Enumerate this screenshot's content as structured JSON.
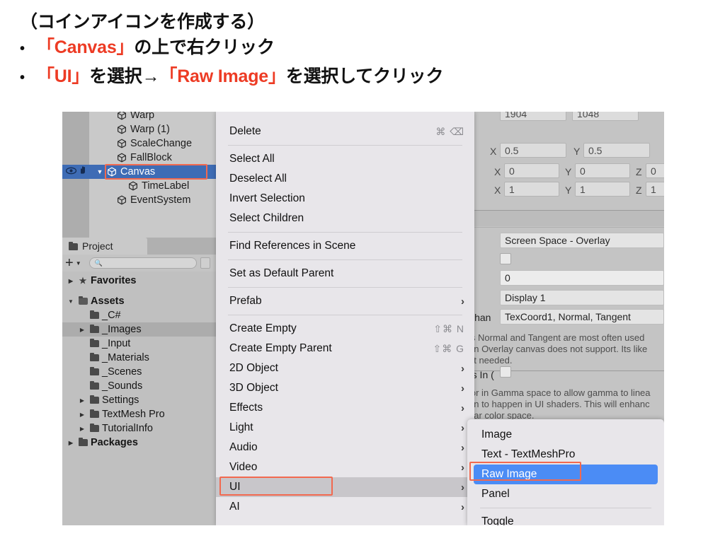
{
  "slide": {
    "title": "（コインアイコンを作成する）",
    "bullets": [
      {
        "marker": "•",
        "parts": [
          {
            "text": "「Canvas」",
            "color": "red"
          },
          {
            "text": "の上で右クリック",
            "color": "black"
          }
        ]
      },
      {
        "marker": "•",
        "parts": [
          {
            "text": "「UI」",
            "color": "red"
          },
          {
            "text": "を選択→",
            "color": "black"
          },
          {
            "text": "「Raw Image」",
            "color": "red"
          },
          {
            "text": "を選択してクリック",
            "color": "black"
          }
        ]
      }
    ],
    "line1_red": "「Canvas」",
    "line1_black": "の上で右クリック",
    "line2_red_a": "「UI」",
    "line2_black_a": "を選択→",
    "line2_red_b": "「Raw Image」",
    "line2_black_b": "を選択してクリック"
  },
  "colors": {
    "accent_red": "#ed3b24",
    "highlight_box": "#f2694f",
    "selection_blue": "#3e6cb5",
    "submenu_blue": "#4b8cf5",
    "panel_gray": "#c9c9c9",
    "menu_bg": "#e8e6ea"
  },
  "hierarchy": {
    "rows": [
      {
        "label": "Warp",
        "indent": 22,
        "triangle": "",
        "selected": false
      },
      {
        "label": "Warp (1)",
        "indent": 22,
        "triangle": "",
        "selected": false
      },
      {
        "label": "ScaleChange",
        "indent": 22,
        "triangle": "",
        "selected": false
      },
      {
        "label": "FallBlock",
        "indent": 22,
        "triangle": "",
        "selected": false
      },
      {
        "label": "Canvas",
        "indent": 8,
        "triangle": "▼",
        "selected": true
      },
      {
        "label": "TimeLabel",
        "indent": 38,
        "triangle": "",
        "selected": false
      },
      {
        "label": "EventSystem",
        "indent": 22,
        "triangle": "",
        "selected": false
      }
    ],
    "gutter_icons": [
      "eye-icon",
      "hand-icon"
    ]
  },
  "project": {
    "tab_label": "Project",
    "add_label": "+",
    "search_value": "",
    "search_placeholder": "",
    "tree": [
      {
        "label": "Favorites",
        "arrow": "▶",
        "icon": "star",
        "indent": 4,
        "bold": true,
        "highlight": false
      },
      {
        "label": "Assets",
        "arrow": "▼",
        "icon": "folder-open",
        "indent": 4,
        "bold": true,
        "highlight": false
      },
      {
        "label": "_C#",
        "arrow": "",
        "icon": "folder",
        "indent": 20,
        "bold": false,
        "highlight": false
      },
      {
        "label": "_Images",
        "arrow": "▶",
        "icon": "folder",
        "indent": 20,
        "bold": false,
        "highlight": true
      },
      {
        "label": "_Input",
        "arrow": "",
        "icon": "folder",
        "indent": 20,
        "bold": false,
        "highlight": false
      },
      {
        "label": "_Materials",
        "arrow": "",
        "icon": "folder",
        "indent": 20,
        "bold": false,
        "highlight": false
      },
      {
        "label": "_Scenes",
        "arrow": "",
        "icon": "folder",
        "indent": 20,
        "bold": false,
        "highlight": false
      },
      {
        "label": "_Sounds",
        "arrow": "",
        "icon": "folder",
        "indent": 20,
        "bold": false,
        "highlight": false
      },
      {
        "label": "Settings",
        "arrow": "▶",
        "icon": "folder",
        "indent": 20,
        "bold": false,
        "highlight": false
      },
      {
        "label": "TextMesh Pro",
        "arrow": "▶",
        "icon": "folder",
        "indent": 20,
        "bold": false,
        "highlight": false
      },
      {
        "label": "TutorialInfo",
        "arrow": "▶",
        "icon": "folder",
        "indent": 20,
        "bold": false,
        "highlight": false
      },
      {
        "label": "Packages",
        "arrow": "▶",
        "icon": "folder",
        "indent": 4,
        "bold": true,
        "highlight": false
      }
    ]
  },
  "context_menu": {
    "items": [
      {
        "label": "Delete",
        "shortcut": "⌘ ⌫",
        "arrow": false,
        "sep_after": true
      },
      {
        "label": "Select All",
        "shortcut": "",
        "arrow": false,
        "sep_after": false
      },
      {
        "label": "Deselect All",
        "shortcut": "",
        "arrow": false,
        "sep_after": false
      },
      {
        "label": "Invert Selection",
        "shortcut": "",
        "arrow": false,
        "sep_after": false
      },
      {
        "label": "Select Children",
        "shortcut": "",
        "arrow": false,
        "sep_after": true
      },
      {
        "label": "Find References in Scene",
        "shortcut": "",
        "arrow": false,
        "sep_after": true
      },
      {
        "label": "Set as Default Parent",
        "shortcut": "",
        "arrow": false,
        "sep_after": true
      },
      {
        "label": "Prefab",
        "shortcut": "",
        "arrow": true,
        "sep_after": true
      },
      {
        "label": "Create Empty",
        "shortcut": "⇧⌘ N",
        "arrow": false,
        "sep_after": false
      },
      {
        "label": "Create Empty Parent",
        "shortcut": "⇧⌘ G",
        "arrow": false,
        "sep_after": false
      },
      {
        "label": "2D Object",
        "shortcut": "",
        "arrow": true,
        "sep_after": false
      },
      {
        "label": "3D Object",
        "shortcut": "",
        "arrow": true,
        "sep_after": false
      },
      {
        "label": "Effects",
        "shortcut": "",
        "arrow": true,
        "sep_after": false
      },
      {
        "label": "Light",
        "shortcut": "",
        "arrow": true,
        "sep_after": false
      },
      {
        "label": "Audio",
        "shortcut": "",
        "arrow": true,
        "sep_after": false
      },
      {
        "label": "Video",
        "shortcut": "",
        "arrow": true,
        "sep_after": false
      },
      {
        "label": "UI",
        "shortcut": "",
        "arrow": true,
        "sep_after": false,
        "highlighted": true
      },
      {
        "label": "AI",
        "shortcut": "",
        "arrow": true,
        "sep_after": false
      }
    ]
  },
  "submenu": {
    "items": [
      {
        "label": "Image",
        "selected": false,
        "sep_after": false
      },
      {
        "label": "Text - TextMeshPro",
        "selected": false,
        "sep_after": false
      },
      {
        "label": "Raw Image",
        "selected": true,
        "sep_after": false
      },
      {
        "label": "Panel",
        "selected": false,
        "sep_after": true
      },
      {
        "label": "Toggle",
        "selected": false,
        "sep_after": false
      }
    ]
  },
  "inspector": {
    "width_value": "1904",
    "height_value": "1048",
    "pivot": {
      "x_label": "X",
      "x_value": "0.5",
      "y_label": "Y",
      "y_value": "0.5"
    },
    "rotation": {
      "x_label": "X",
      "x_value": "0",
      "y_label": "Y",
      "y_value": "0",
      "z_label": "Z",
      "z_value": "0"
    },
    "scale": {
      "x_label": "X",
      "x_value": "1",
      "y_label": "Y",
      "y_value": "1",
      "z_label": "Z",
      "z_value": "1"
    },
    "render_mode": "Screen Space - Overlay",
    "pixel_perfect_checked": false,
    "sort_order": "0",
    "target_display": "Display 1",
    "additional_shader_channels_label": "Chan",
    "additional_shader_channels": "TexCoord1, Normal, Tangent",
    "help_lines": [
      "ls Normal and Tangent are most often used",
      "an Overlay canvas does not support. Its like",
      "ot needed."
    ],
    "gamma_label": "rs In (",
    "gamma_help_lines": [
      "lor in Gamma space to allow gamma to linea",
      "on to happen in UI shaders. This will enhanc",
      "ear color space."
    ]
  }
}
